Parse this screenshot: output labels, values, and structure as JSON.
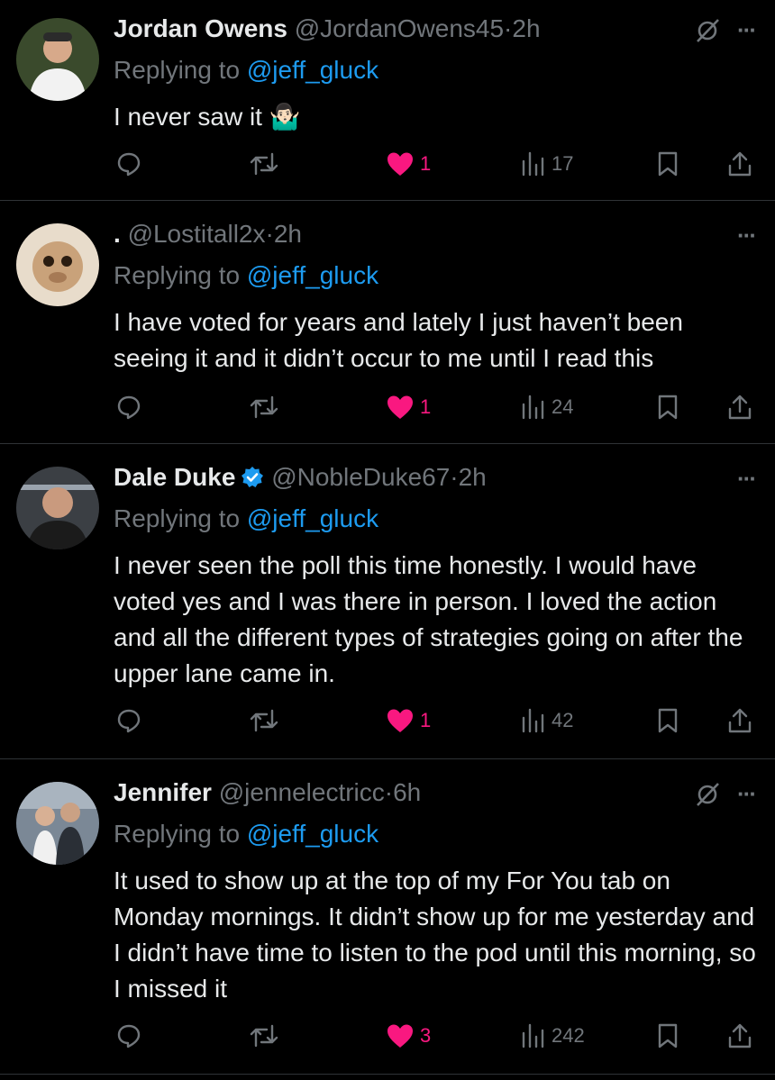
{
  "tweets": [
    {
      "name": "Jordan Owens",
      "handle": "@JordanOwens45",
      "time": "2h",
      "verified": false,
      "show_topic_icon": true,
      "replying_prefix": "Replying to",
      "replying_to": "@jeff_gluck",
      "text": "I never saw it 🤷🏻‍♂️",
      "likes": "1",
      "views": "17"
    },
    {
      "name": ".",
      "handle": "@Lostitall2x",
      "time": "2h",
      "verified": false,
      "show_topic_icon": false,
      "replying_prefix": "Replying to",
      "replying_to": "@jeff_gluck",
      "text": "I have voted for years and lately I just haven’t been seeing it and it didn’t occur to me until I read this",
      "likes": "1",
      "views": "24"
    },
    {
      "name": "Dale Duke",
      "handle": "@NobleDuke67",
      "time": "2h",
      "verified": true,
      "show_topic_icon": false,
      "replying_prefix": "Replying to",
      "replying_to": "@jeff_gluck",
      "text": "I never seen the poll this time honestly. I would have voted yes and I was there in person. I loved the action and all the different types of strategies going on after the upper lane came in.",
      "likes": "1",
      "views": "42"
    },
    {
      "name": "Jennifer",
      "handle": "@jennelectricc",
      "time": "6h",
      "verified": false,
      "show_topic_icon": true,
      "replying_prefix": "Replying to",
      "replying_to": "@jeff_gluck",
      "text": "It used to show up at the top of my For You tab on Monday mornings. It didn’t show up for me yesterday and I didn’t have time to listen to the pod until this morning, so I missed it",
      "likes": "3",
      "views": "242"
    }
  ],
  "ui": {
    "dot": "·",
    "more": "···"
  },
  "colors": {
    "background": "#000000",
    "text": "#e7e9ea",
    "muted": "#71767b",
    "link": "#1d9bf0",
    "like": "#f91880",
    "divider": "#2f3336"
  }
}
